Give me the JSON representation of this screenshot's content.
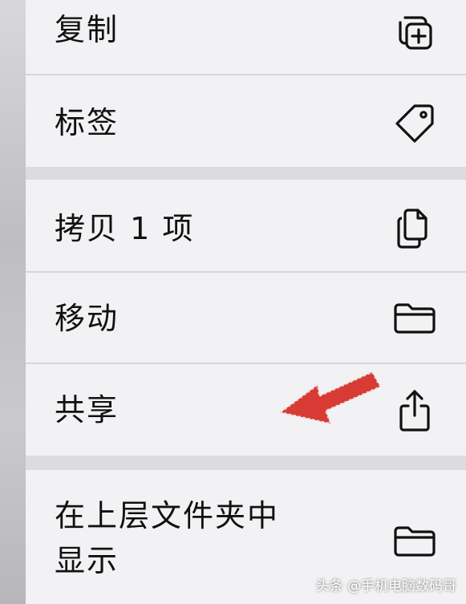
{
  "menu": {
    "items": [
      {
        "label": "复制",
        "icon": "duplicate-icon"
      },
      {
        "label": "标签",
        "icon": "tag-icon"
      },
      {
        "label": "拷贝 1 项",
        "icon": "copy-documents-icon"
      },
      {
        "label": "移动",
        "icon": "folder-icon"
      },
      {
        "label": "共享",
        "icon": "share-icon"
      },
      {
        "label_line1": "在上层文件夹中",
        "label_line2": "显示",
        "icon": "folder-icon"
      }
    ]
  },
  "annotation": {
    "icon": "red-arrow-icon",
    "color": "#d83a34"
  },
  "watermark": {
    "text": "头条 @手机电脑数码哥"
  }
}
